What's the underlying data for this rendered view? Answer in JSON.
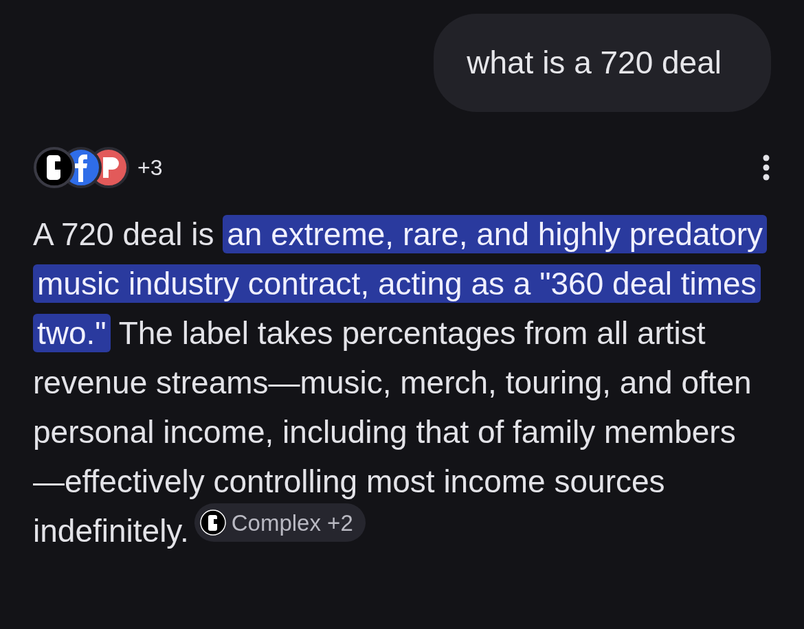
{
  "prompt": {
    "text": "what is a 720 deal"
  },
  "sources": {
    "count": "+3"
  },
  "answer": {
    "segments": [
      {
        "text": "A 720 deal is ",
        "highlighted": false
      },
      {
        "text": "an extreme, rare, and highly predatory music industry contract, acting as a \"360 deal times two.\"",
        "highlighted": true
      },
      {
        "text": " The label takes percentages from all artist revenue streams—music, merch, touring, and often personal income, including that of family members—effectively controlling most income sources indefinitely.",
        "highlighted": false
      }
    ],
    "citation": {
      "label": "Complex +2"
    }
  }
}
